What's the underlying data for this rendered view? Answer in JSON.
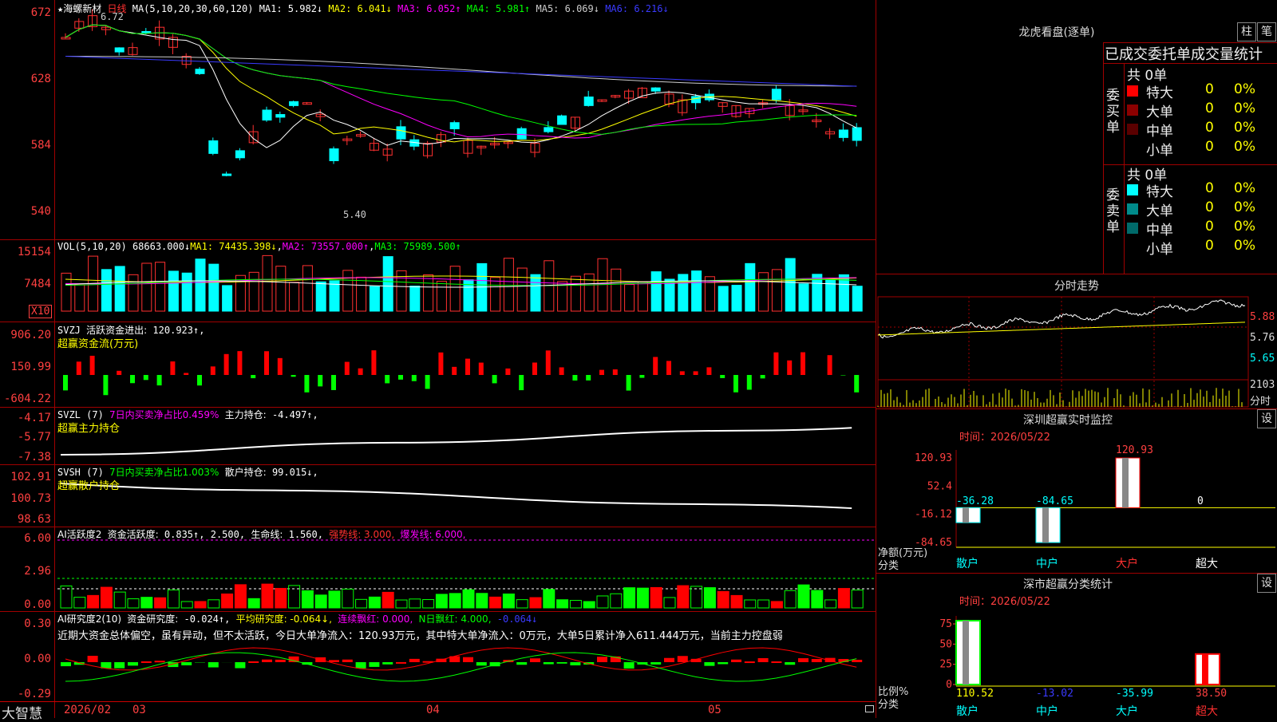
{
  "stock": {
    "star": "★",
    "name": "海螺新材",
    "period": "日线",
    "ma_params": "MA(5,10,20,30,60,120)",
    "ma_values": [
      {
        "label": "MA1:",
        "value": "5.982↓",
        "color": "#ffffff"
      },
      {
        "label": "MA2:",
        "value": "6.041↓",
        "color": "#ffff00"
      },
      {
        "label": "MA3:",
        "value": "6.052↑",
        "color": "#ff00ff"
      },
      {
        "label": "MA4:",
        "value": "5.981↑",
        "color": "#00ff00"
      },
      {
        "label": "MA5:",
        "value": "6.069↓",
        "color": "#cccccc"
      },
      {
        "label": "MA6:",
        "value": "6.216↓",
        "color": "#3a3aff"
      }
    ],
    "high_mark": "6.72",
    "low_mark": "5.40",
    "y_labels": [
      "672",
      "628",
      "584",
      "540"
    ]
  },
  "vol": {
    "header": "VOL(5,10,20)",
    "value": "68663.000↓",
    "ma1": "MA1: 74435.398↓",
    "ma2": "MA2: 73557.000↑",
    "ma3": "MA3: 75989.500↑",
    "y_labels": [
      "15154",
      "7484"
    ],
    "unit": "X10"
  },
  "svzj": {
    "name": "SVZJ",
    "label": "活跃资金进出:",
    "value": "120.923↑,",
    "sub": "超赢资金流(万元)",
    "y_labels": [
      "906.20",
      "150.99",
      "-604.22"
    ]
  },
  "svzl": {
    "name": "SVZL (7)",
    "ratio": "7日内买卖净占比0.459%",
    "label": "主力持仓:",
    "value": "-4.497↑,",
    "sub": "超赢主力持仓",
    "y_labels": [
      "-4.17",
      "-5.77",
      "-7.38"
    ]
  },
  "svsh": {
    "name": "SVSH (7)",
    "ratio": "7日内买卖净占比1.003%",
    "label": "散户持仓:",
    "value": "99.015↓,",
    "sub": "超赢散户持仓",
    "y_labels": [
      "102.91",
      "100.73",
      "98.63"
    ]
  },
  "ai_active": {
    "name": "AI活跃度2",
    "label": "资金活跃度:",
    "value": "0.835↑,",
    "v2": "2.500,",
    "life_label": "生命线:",
    "life": "1.560,",
    "strong": "强势线: 3.000,",
    "burst": "爆发线: 6.000,",
    "y_labels": [
      "6.00",
      "2.96",
      "0.00"
    ]
  },
  "ai_research": {
    "name": "AI研究度2(10)",
    "label": "资金研究度:",
    "value": "-0.024↑,",
    "avg": "平均研究度: -0.064↓,",
    "red": "连续飘红: 0.000,",
    "nred": "N日飘红: 4.000,",
    "last": "-0.064↓",
    "comment": "近期大资金总体偏空，虽有异动，但不太活跃，今日大单净流入：120.93万元，其中特大单净流入：0万元，大单5日累计净入611.444万元，当前主力控盘弱",
    "y_labels": [
      "0.30",
      "0.00",
      "-0.29"
    ]
  },
  "bottom_axis": {
    "logo": "大智慧",
    "dates": [
      "2026/02",
      "03",
      "04",
      "05"
    ]
  },
  "dragon": {
    "title": "龙虎看盘(逐单)",
    "btn1": "柱",
    "btn2": "笔",
    "subtitle": "已成交委托单成交量统计",
    "buy_label": "委买单",
    "sell_label": "委卖单",
    "buy_total": "共 0单",
    "sell_total": "共 0单",
    "buy_rows": [
      {
        "label": "特大",
        "count": "0",
        "pct": "0%",
        "color": "#ff0000"
      },
      {
        "label": "大单",
        "count": "0",
        "pct": "0%",
        "color": "#8b0000"
      },
      {
        "label": "中单",
        "count": "0",
        "pct": "0%",
        "color": "#5a0000"
      },
      {
        "label": "小单",
        "count": "0",
        "pct": "0%",
        "color": "#000000"
      }
    ],
    "sell_rows": [
      {
        "label": "特大",
        "count": "0",
        "pct": "0%",
        "color": "#00ffff"
      },
      {
        "label": "大单",
        "count": "0",
        "pct": "0%",
        "color": "#008b8b"
      },
      {
        "label": "中单",
        "count": "0",
        "pct": "0%",
        "color": "#006a6a"
      },
      {
        "label": "小单",
        "count": "0",
        "pct": "0%",
        "color": "#000000"
      }
    ]
  },
  "intraday": {
    "title": "分时走势",
    "y_labels": [
      "5.88",
      "5.76",
      "5.65"
    ],
    "vol_label": "2103",
    "vol_unit": "分时"
  },
  "sz_monitor": {
    "title": "深圳超赢实时监控",
    "btn": "设",
    "time": "时间：2026/05/22",
    "y_labels": [
      "120.93",
      "52.4",
      "-16.12",
      "-84.65"
    ],
    "axis_label": "净额(万元)",
    "cat_label": "分类",
    "categories": [
      "散户",
      "中户",
      "大户",
      "超大"
    ],
    "values": [
      -36.28,
      -84.65,
      120.93,
      0
    ],
    "value_labels": [
      "-36.28",
      "-84.65",
      "120.93",
      "0"
    ]
  },
  "sz_class": {
    "title": "深市超赢分类统计",
    "btn": "设",
    "time": "时间：2026/05/22",
    "y_labels": [
      "75",
      "50",
      "25",
      "0"
    ],
    "axis_label": "比例%",
    "cat_label": "分类",
    "categories": [
      "散户",
      "中户",
      "大户",
      "超大"
    ],
    "values": [
      110.52,
      -13.02,
      -35.99,
      38.5
    ],
    "value_labels": [
      "110.52",
      "-13.02",
      "-35.99",
      "38.50"
    ]
  }
}
